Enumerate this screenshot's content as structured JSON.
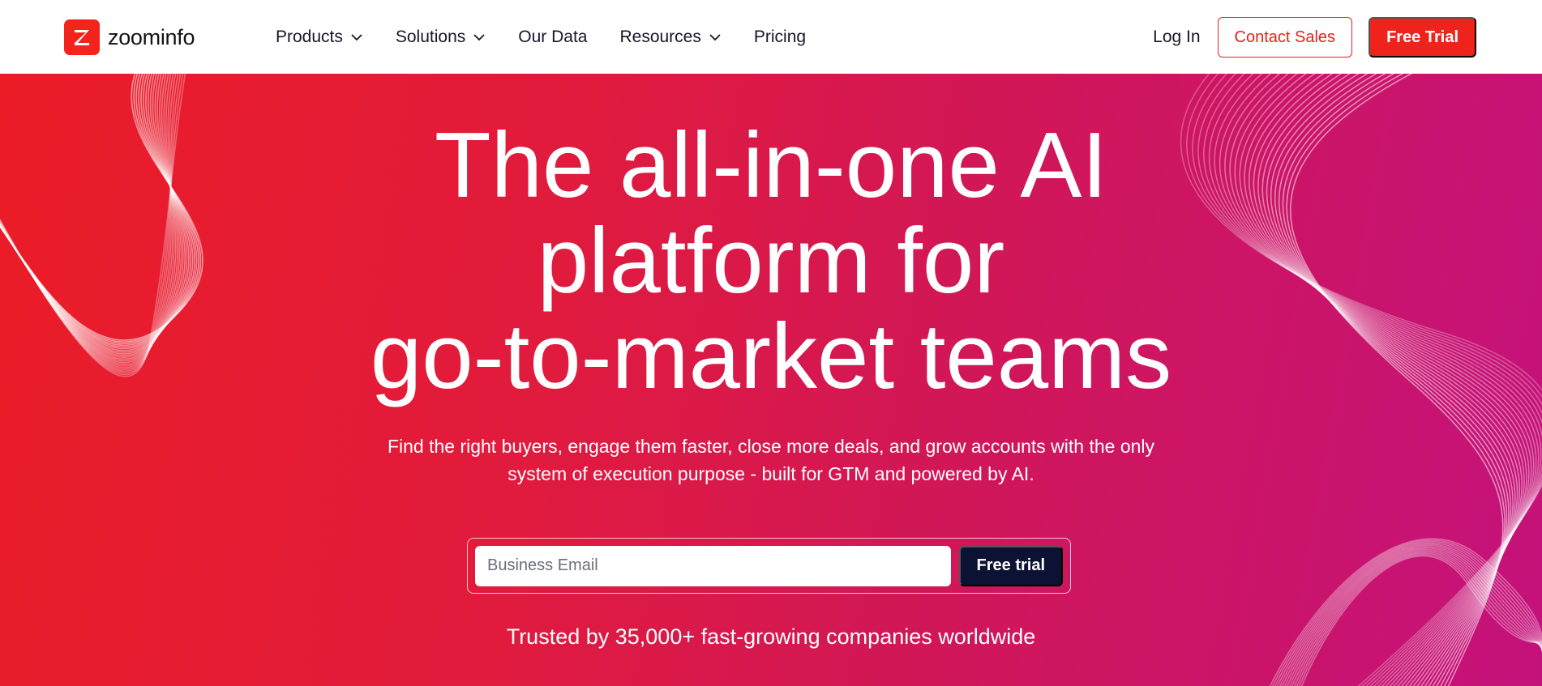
{
  "nav": {
    "logo_text": "zoominfo",
    "items": [
      {
        "label": "Products",
        "has_dropdown": true
      },
      {
        "label": "Solutions",
        "has_dropdown": true
      },
      {
        "label": "Our Data",
        "has_dropdown": false
      },
      {
        "label": "Resources",
        "has_dropdown": true
      },
      {
        "label": "Pricing",
        "has_dropdown": false
      }
    ],
    "login_label": "Log In",
    "contact_label": "Contact Sales",
    "trial_label": "Free Trial"
  },
  "hero": {
    "headline_line1": "The all-in-one AI",
    "headline_line2": "platform for",
    "headline_line3": "go-to-market teams",
    "subtitle_line1": "Find the right buyers, engage them faster, close more deals, and grow accounts with the only",
    "subtitle_line2": "system of execution purpose - built for GTM and powered by AI.",
    "email_placeholder": "Business Email",
    "email_value": "",
    "cta_label": "Free trial",
    "trusted_text": "Trusted by 35,000+ fast-growing companies worldwide"
  },
  "colors": {
    "brand_red": "#ee241c",
    "dark_navy": "#0c1233",
    "gradient_start": "#eb1c26",
    "gradient_end": "#c4127b"
  },
  "icons": {
    "logo": "zoominfo-z-logo-icon",
    "dropdown": "chevron-down-icon"
  }
}
